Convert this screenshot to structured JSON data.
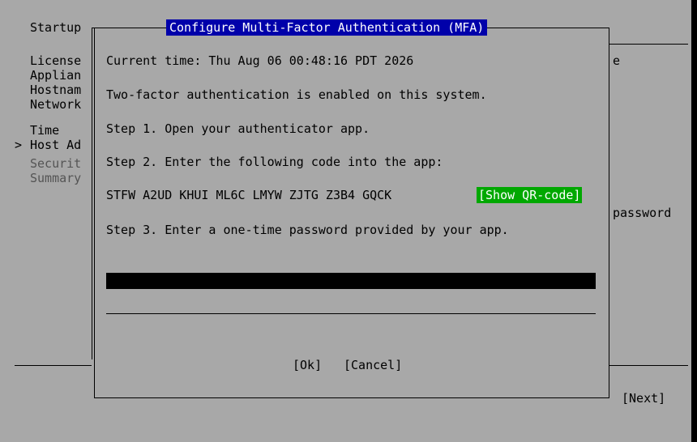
{
  "background": {
    "header_title": "Startup",
    "sidebar_items": [
      {
        "label": "License",
        "muted": false,
        "selected": false
      },
      {
        "label": "Applian",
        "muted": false,
        "selected": false
      },
      {
        "label": "Hostnam",
        "muted": false,
        "selected": false
      },
      {
        "label": "Network",
        "muted": false,
        "selected": false
      },
      {
        "label": "Time",
        "muted": false,
        "selected": false
      },
      {
        "label": "Host Ad",
        "muted": false,
        "selected": true
      },
      {
        "label": "Securit",
        "muted": true,
        "selected": false
      },
      {
        "label": "Summary",
        "muted": true,
        "selected": false
      }
    ],
    "selection_marker": ">",
    "right_fragment_1": "e",
    "right_fragment_2": "password",
    "next_label": "[Next]"
  },
  "dialog": {
    "title": "Configure Multi-Factor Authentication (MFA)",
    "current_time": "Current time: Thu Aug 06 00:48:16 PDT 2026",
    "status": "Two-factor authentication is enabled on this system.",
    "step1": "Step 1. Open your authenticator app.",
    "step2": "Step 2. Enter the following code into the app:",
    "secret_code": "STFW A2UD KHUI ML6C LMYW ZJTG Z3B4 GQCK",
    "show_qr_label": "[Show QR-code]",
    "step3": "Step 3. Enter a one-time password provided by your app.",
    "otp_value": "",
    "ok_label": "[Ok]",
    "cancel_label": "[Cancel]"
  },
  "colors": {
    "background_gray": "#a8a8a8",
    "title_blue": "#0000aa",
    "qr_button_green": "#00a800",
    "muted_text": "#545454"
  }
}
